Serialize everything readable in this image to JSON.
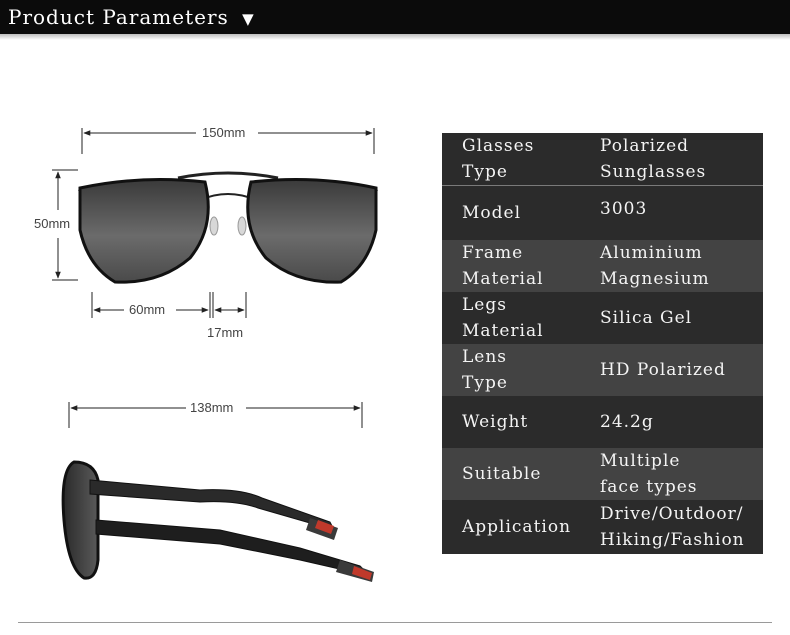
{
  "header": {
    "title": "Product Parameters",
    "arrow": "▼"
  },
  "front_view": {
    "total_width": "150mm",
    "height": "50mm",
    "lens_width": "60mm",
    "bridge": "17mm"
  },
  "side_view": {
    "temple_length": "138mm"
  },
  "colors": {
    "header_bg": "#0b0b0b",
    "table_dark": "#2b2b2b",
    "table_mid": "#434343",
    "temple_tip": "#c0392b"
  },
  "specs": [
    {
      "label": "Glasses\nType",
      "value": "Polarized\nSunglasses"
    },
    {
      "label": "Model",
      "value": "3003"
    },
    {
      "label": "Frame\nMaterial",
      "value": "Aluminium\nMagnesium"
    },
    {
      "label": "Legs\nMaterial",
      "value": "Silica Gel"
    },
    {
      "label": "Lens\nType",
      "value": "HD Polarized"
    },
    {
      "label": "Weight",
      "value": "24.2g"
    },
    {
      "label": "Suitable",
      "value": "Multiple\nface types"
    },
    {
      "label": "Application",
      "value": "Drive/Outdoor/\nHiking/Fashion"
    }
  ]
}
